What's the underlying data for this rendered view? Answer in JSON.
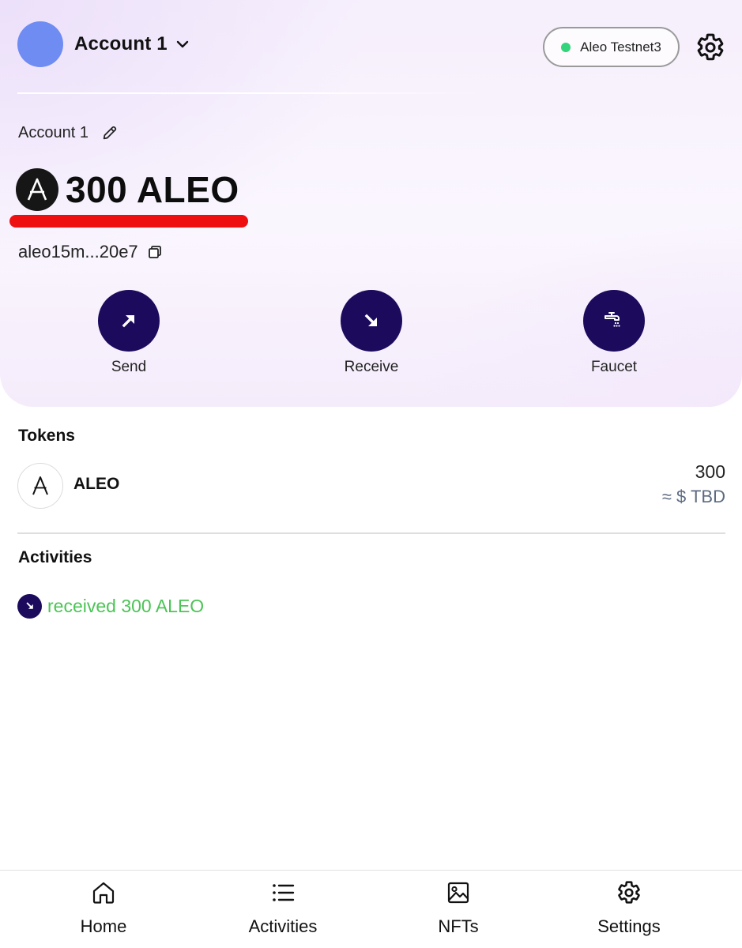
{
  "header": {
    "account_name": "Account 1",
    "network": "Aleo Testnet3",
    "network_status_color": "#33d47c",
    "avatar_color": "#6f8cf2"
  },
  "account": {
    "label": "Account 1",
    "balance": "300 ALEO",
    "address": "aleo15m...20e7"
  },
  "actions": [
    {
      "label": "Send",
      "icon": "arrow-up-right-icon"
    },
    {
      "label": "Receive",
      "icon": "arrow-down-right-icon"
    },
    {
      "label": "Faucet",
      "icon": "faucet-icon"
    }
  ],
  "tokens": {
    "title": "Tokens",
    "items": [
      {
        "symbol": "ALEO",
        "amount": "300",
        "fiat": "≈ $ TBD"
      }
    ]
  },
  "activities": {
    "title": "Activities",
    "items": [
      {
        "text": "received 300 ALEO",
        "color": "#4cc456"
      }
    ]
  },
  "nav": [
    {
      "label": "Home",
      "icon": "home-icon"
    },
    {
      "label": "Activities",
      "icon": "list-icon"
    },
    {
      "label": "NFTs",
      "icon": "image-icon"
    },
    {
      "label": "Settings",
      "icon": "gear-icon"
    }
  ],
  "colors": {
    "accent_dark": "#1c0a5c",
    "highlight_underline": "#ee0f10"
  }
}
